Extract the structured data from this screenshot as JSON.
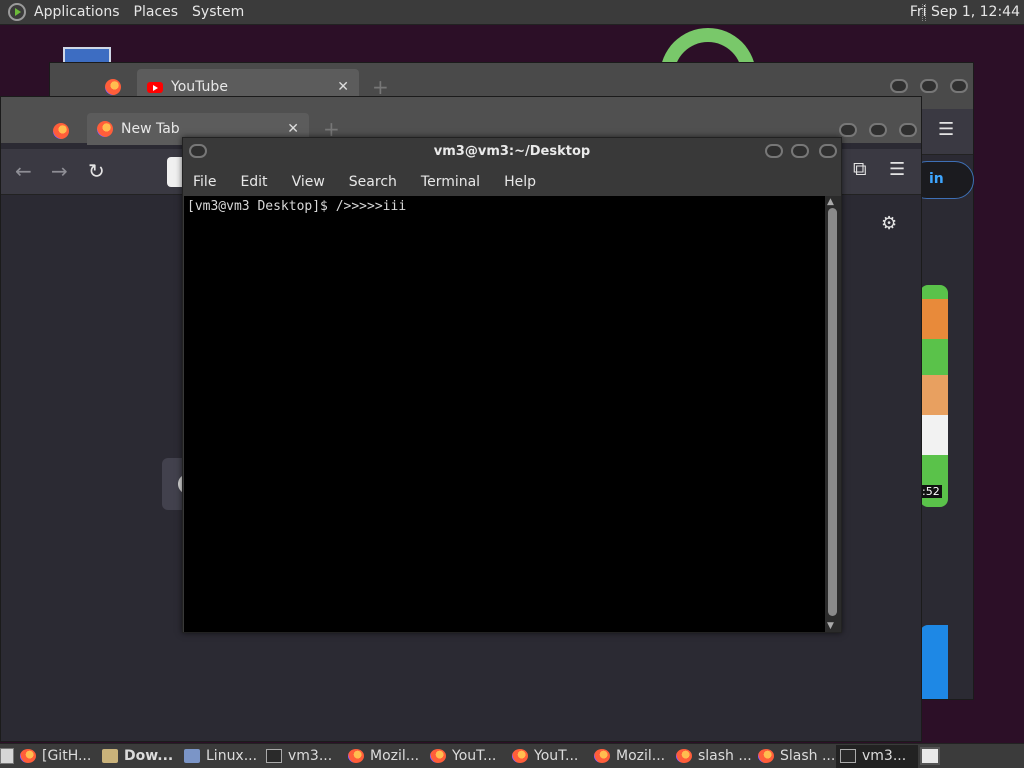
{
  "top_panel": {
    "menus": [
      "Applications",
      "Places",
      "System"
    ],
    "clock": "Fri Sep  1, 12:44"
  },
  "browser_back": {
    "tab": {
      "title": "YouTube"
    },
    "sign_in": "in",
    "video_duration": ":52"
  },
  "browser_front": {
    "tab": {
      "title": "New Tab"
    }
  },
  "terminal": {
    "title": "vm3@vm3:~/Desktop",
    "menu": [
      "File",
      "Edit",
      "View",
      "Search",
      "Terminal",
      "Help"
    ],
    "lines": [
      "[vm3@vm3 Desktop]$ />>>>>iii"
    ]
  },
  "taskbar": {
    "tasks": [
      {
        "label": "[GitH...",
        "icon": "firefox-icon"
      },
      {
        "label": "Dow...",
        "icon": "folder-icon"
      },
      {
        "label": "Linux...",
        "icon": "document-icon"
      },
      {
        "label": "vm3...",
        "icon": "terminal-icon"
      },
      {
        "label": "Mozil...",
        "icon": "firefox-icon"
      },
      {
        "label": "YouT...",
        "icon": "firefox-icon"
      },
      {
        "label": "YouT...",
        "icon": "firefox-icon"
      },
      {
        "label": "Mozil...",
        "icon": "firefox-icon"
      },
      {
        "label": "slash ...",
        "icon": "firefox-icon"
      },
      {
        "label": "Slash ...",
        "icon": "firefox-icon"
      },
      {
        "label": "vm3...",
        "icon": "terminal-icon"
      }
    ]
  }
}
